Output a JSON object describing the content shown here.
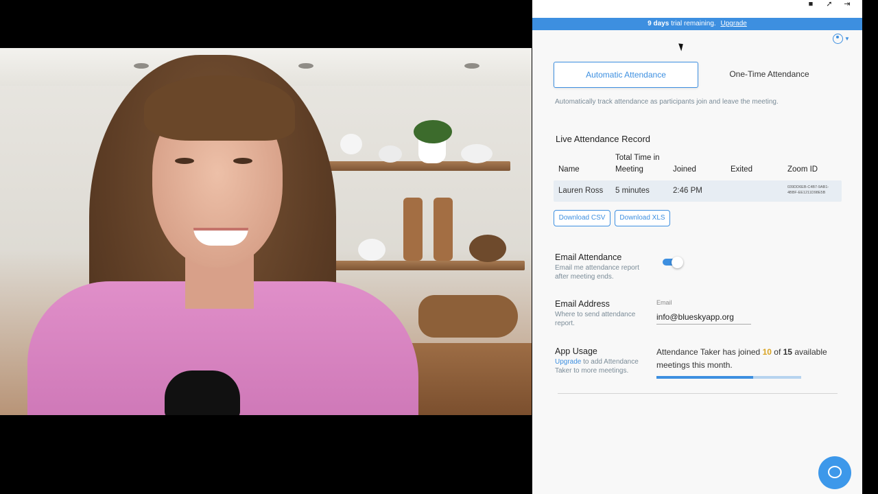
{
  "trial_banner": {
    "days": "9 days",
    "text": "trial remaining.",
    "link": "Upgrade"
  },
  "top_icons": [
    "download-icon",
    "pin-icon",
    "exit-icon"
  ],
  "tabs": [
    {
      "label": "Automatic Attendance",
      "active": true
    },
    {
      "label": "One-Time Attendance",
      "active": false
    }
  ],
  "description": "Automatically track attendance as participants join and leave the meeting.",
  "live_record": {
    "title": "Live Attendance Record",
    "headers": {
      "name": "Name",
      "total_time_line1": "Total Time in",
      "total_time_line2": "Meeting",
      "joined": "Joined",
      "exited": "Exited",
      "zoom_id": "Zoom ID"
    },
    "rows": [
      {
        "name": "Lauren Ross",
        "total_time": "5 minutes",
        "joined": "2:46 PM",
        "exited": "",
        "zoom_id": "039DD6EB-C4B7-9AB1-4BBF-EE1211D98E5B"
      }
    ]
  },
  "downloads": {
    "csv": "Download CSV",
    "xls": "Download XLS"
  },
  "email_attendance": {
    "title": "Email Attendance",
    "subtitle": "Email me attendance report after meeting ends.",
    "enabled": true
  },
  "email_address": {
    "title": "Email Address",
    "subtitle": "Where to send attendance report.",
    "field_label": "Email",
    "value": "info@blueskyapp.org"
  },
  "app_usage": {
    "title": "App Usage",
    "subtitle_link": "Upgrade",
    "subtitle_rest": "to add Attendance Taker to more meetings.",
    "text_before": "Attendance Taker has joined",
    "joined": "10",
    "text_of": "of",
    "available": "15",
    "text_after": "available meetings this month.",
    "progress_fraction": 0.667
  },
  "colors": {
    "accent": "#3d8fe0",
    "highlight": "#d9a321",
    "panel_bg": "#f8f8f8"
  }
}
